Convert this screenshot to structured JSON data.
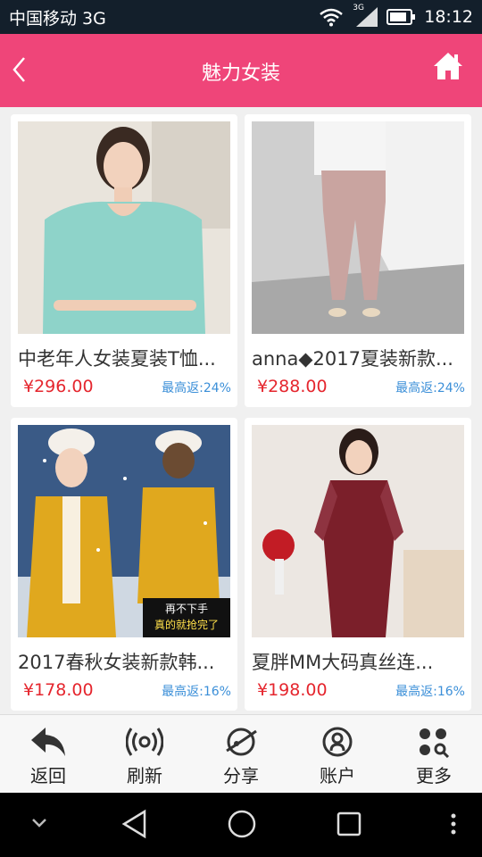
{
  "status_bar": {
    "carrier": "中国移动 3G",
    "signal_label": "3G",
    "time": "18:12"
  },
  "header": {
    "title": "魅力女装",
    "back_icon": "chevron-left-icon",
    "home_icon": "home-icon"
  },
  "products": [
    {
      "name": "中老年人女装夏装T恤...",
      "price": "¥296.00",
      "rebate": "最高返:24%"
    },
    {
      "name": "anna◆2017夏装新款...",
      "price": "¥288.00",
      "rebate": "最高返:24%"
    },
    {
      "name": "2017春秋女装新款韩...",
      "price": "¥178.00",
      "rebate": "最高返:16%",
      "badge_line1": "再不下手",
      "badge_line2": "真的就抢完了"
    },
    {
      "name": "夏胖MM大码真丝连...",
      "price": "¥198.00",
      "rebate": "最高返:16%"
    }
  ],
  "bottom_nav": [
    {
      "label": "返回",
      "icon": "reply-arrow-icon"
    },
    {
      "label": "刷新",
      "icon": "broadcast-icon"
    },
    {
      "label": "分享",
      "icon": "planet-icon"
    },
    {
      "label": "账户",
      "icon": "account-icon"
    },
    {
      "label": "更多",
      "icon": "grid-search-icon"
    }
  ],
  "colors": {
    "header_bg": "#ef4579",
    "price": "#e5262e",
    "rebate": "#3b8fd8",
    "status_bg": "#131f2b"
  }
}
